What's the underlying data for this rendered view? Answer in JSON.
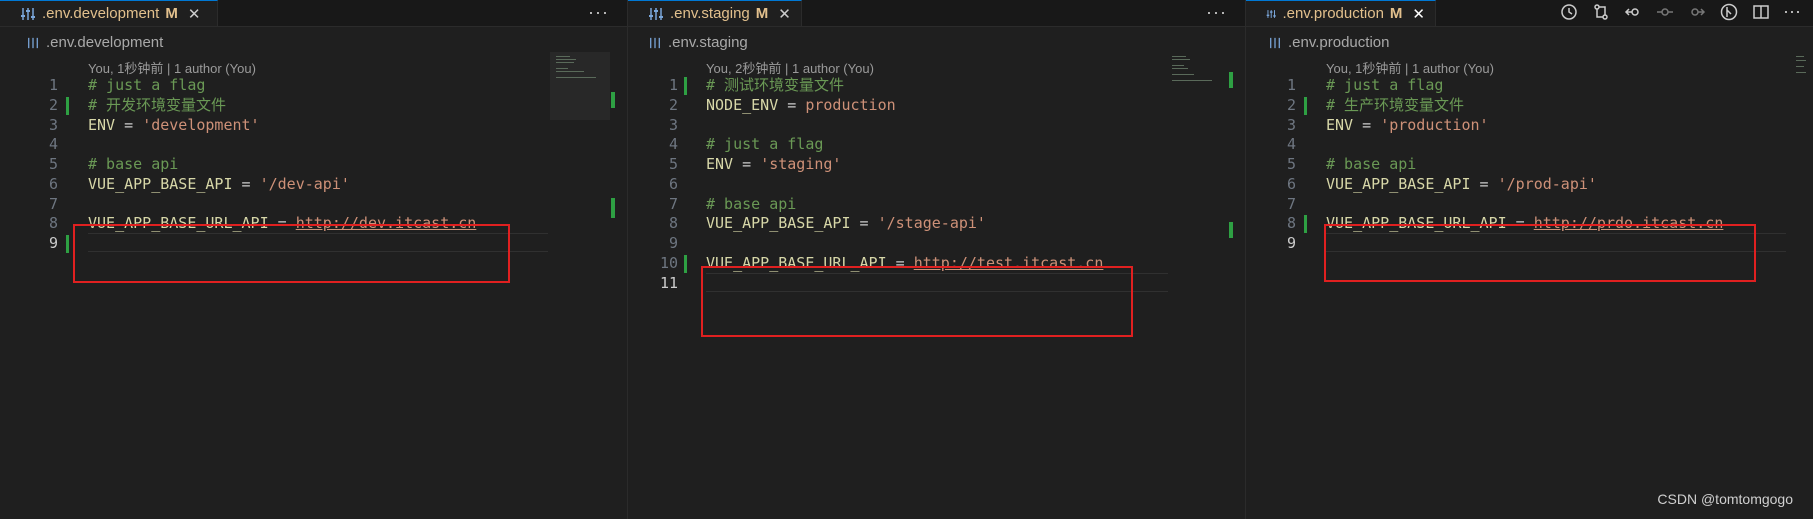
{
  "panes": [
    {
      "tab_name": ".env.development",
      "tab_badge": "M",
      "close_glyph": "✕",
      "more_glyph": "···",
      "breadcrumb": ".env.development",
      "blame": "You, 1秒钟前 | 1 author (You)",
      "active_line": "9",
      "lines": [
        {
          "n": "1",
          "text": "# just a flag"
        },
        {
          "n": "2",
          "text": "# 开发环境变量文件"
        },
        {
          "n": "3",
          "key": "ENV",
          "op": " = ",
          "val": "'development'"
        },
        {
          "n": "4",
          "text": ""
        },
        {
          "n": "5",
          "text": "# base api"
        },
        {
          "n": "6",
          "key": "VUE_APP_BASE_API",
          "op": " = ",
          "val": "'/dev-api'"
        },
        {
          "n": "7",
          "text": ""
        },
        {
          "n": "8",
          "key": "VUE_APP_BASE_URL_API",
          "op": " = ",
          "url": "http://dev.itcast.cn"
        },
        {
          "n": "9",
          "text": ""
        }
      ]
    },
    {
      "tab_name": ".env.staging",
      "tab_badge": "M",
      "close_glyph": "✕",
      "more_glyph": "···",
      "breadcrumb": ".env.staging",
      "blame": "You, 2秒钟前 | 1 author (You)",
      "active_line": "11",
      "lines": [
        {
          "n": "1",
          "text": "# 测试环境变量文件"
        },
        {
          "n": "2",
          "key": "NODE_ENV",
          "op": " = ",
          "plain": "production"
        },
        {
          "n": "3",
          "text": ""
        },
        {
          "n": "4",
          "text": "# just a flag"
        },
        {
          "n": "5",
          "key": "ENV",
          "op": " = ",
          "val": "'staging'"
        },
        {
          "n": "6",
          "text": ""
        },
        {
          "n": "7",
          "text": "# base api"
        },
        {
          "n": "8",
          "key": "VUE_APP_BASE_API",
          "op": " = ",
          "val": "'/stage-api'"
        },
        {
          "n": "9",
          "text": ""
        },
        {
          "n": "10",
          "key": "VUE_APP_BASE_URL_API",
          "op": " = ",
          "url": "http://test.itcast.cn"
        },
        {
          "n": "11",
          "text": ""
        }
      ]
    },
    {
      "tab_name": ".env.production",
      "tab_badge": "M",
      "close_glyph": "✕",
      "breadcrumb": ".env.production",
      "blame": "You, 1秒钟前 | 1 author (You)",
      "active_line": "9",
      "lines": [
        {
          "n": "1",
          "text": "# just a flag"
        },
        {
          "n": "2",
          "text": "# 生产环境变量文件"
        },
        {
          "n": "3",
          "key": "ENV",
          "op": " = ",
          "val": "'production'"
        },
        {
          "n": "4",
          "text": ""
        },
        {
          "n": "5",
          "text": "# base api"
        },
        {
          "n": "6",
          "key": "VUE_APP_BASE_API",
          "op": " = ",
          "val": "'/prod-api'"
        },
        {
          "n": "7",
          "text": ""
        },
        {
          "n": "8",
          "key": "VUE_APP_BASE_URL_API",
          "op": " = ",
          "url": "http://prdo.itcast.cn"
        },
        {
          "n": "9",
          "text": ""
        }
      ]
    }
  ],
  "toolbar_icons": [
    "history-icon",
    "git-compare-icon",
    "go-back-icon",
    "go-to-change-icon",
    "go-forward-icon",
    "git-blame-icon",
    "split-editor-icon",
    "more-actions-icon"
  ],
  "watermark": "CSDN @tomtomgogo",
  "colors": {
    "comment": "#6a9955",
    "key": "#d7d7a8",
    "string": "#ce9178",
    "modified_tab": "#e2c08d",
    "gutter_added": "#2ea043",
    "highlight_box": "#e02020"
  }
}
